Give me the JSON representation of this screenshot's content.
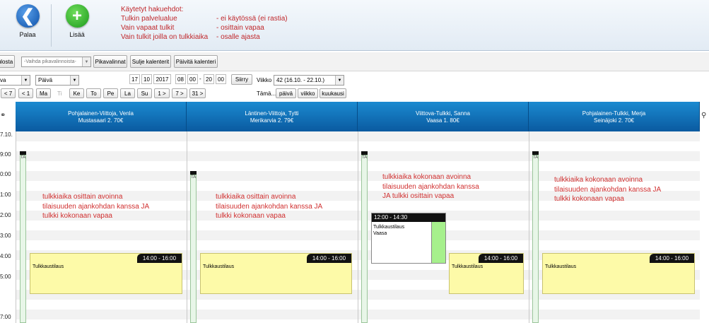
{
  "toolbar": {
    "back_label": "Palaa",
    "add_label": "Lisää"
  },
  "criteria": {
    "title": "Käytetyt hakuehdot:",
    "items": [
      {
        "label": "Tulkin palvelualue",
        "value": "- ei käytössä (ei rastia)"
      },
      {
        "label": "Vain vapaat tulkit",
        "value": "- osittain vapaa"
      },
      {
        "label": "Vain tulkit joilla on tulkkiaika",
        "value": "- osalle ajasta"
      }
    ]
  },
  "actions": {
    "print_label": "ulosta",
    "quick_select": "-Vaihda pikavalinnoista-",
    "quick_btn": "Pikavalinnat",
    "close_btn": "Sulje kalenterit",
    "refresh_btn": "Päivitä kalenteri"
  },
  "filters": {
    "view_select": "va",
    "period_select": "Päivä",
    "day": "17",
    "month": "10",
    "year": "2017",
    "hour_from": "08",
    "min_from": "00",
    "hour_to": "20",
    "min_to": "00",
    "go_label": "Siirry",
    "week_label": "Viikko",
    "week_value": "42 (16.10. - 22.10.)"
  },
  "nav": {
    "buttons": [
      "< 7",
      "< 1",
      "Ma",
      "Ti",
      "Ke",
      "To",
      "Pe",
      "La",
      "Su",
      "1 >",
      "7 >",
      "31 >"
    ],
    "tama": "Tämä...",
    "this_buttons": [
      "päivä",
      "viikko",
      "kuukausi"
    ]
  },
  "calendar": {
    "date_label": "7.10.",
    "hours": [
      "9:00",
      "0:00",
      "1:00",
      "2:00",
      "3:00",
      "4:00",
      "5:00",
      "7:00"
    ],
    "interpreters": [
      {
        "name": "Pohjalainen-Viittoja, Venla",
        "info": "Mustasaari  2. 70€"
      },
      {
        "name": "Läntinen-Viittoja, Tytti",
        "info": "Merikarvia  2. 79€"
      },
      {
        "name": "Viittova-Tulkki, Sanna",
        "info": "Vaasa  1. 80€"
      },
      {
        "name": "Pohjalainen-Tulkki, Merja",
        "info": "Seinäjoki  2. 70€"
      }
    ],
    "ta_label": "TA",
    "bookings": [
      {
        "time": "14:00 - 16:00",
        "title": "Tulkkaustilaus"
      },
      {
        "time": "14:00 - 16:00",
        "title": "Tulkkaustilaus"
      },
      {
        "time": "14:00 - 16:00",
        "title": "Tulkkaustilaus"
      },
      {
        "time": "14:00 - 16:00",
        "title": "Tulkkaustilaus"
      }
    ],
    "existing": {
      "time": "12:00 - 14:30",
      "title": "Tulkkaustilaus",
      "place": "Vaasa"
    },
    "notes": [
      {
        "l1": "tulkkiaika osittain avoinna",
        "l2": "tilaisuuden ajankohdan kanssa JA",
        "l3": "tulkki kokonaan vapaa"
      },
      {
        "l1": "tulkkiaika osittain avoinna",
        "l2": "tilaisuuden ajankohdan kanssa JA",
        "l3": "tulkki kokonaan vapaa"
      },
      {
        "l1": "tulkkiaika kokonaan avoinna",
        "l2": "tilaisuuden ajankohdan kanssa",
        "l3": "JA tulkki osittain vapaa"
      },
      {
        "l1": "tulkkiaika kokonaan avoinna",
        "l2": "tilaisuuden ajankohdan kanssa JA",
        "l3": "tulkki kokonaan vapaa"
      }
    ]
  },
  "colors": {
    "header": "#0a5aa0",
    "booking": "#fdfaa8",
    "note": "#d03030",
    "free": "#a6f08c"
  }
}
